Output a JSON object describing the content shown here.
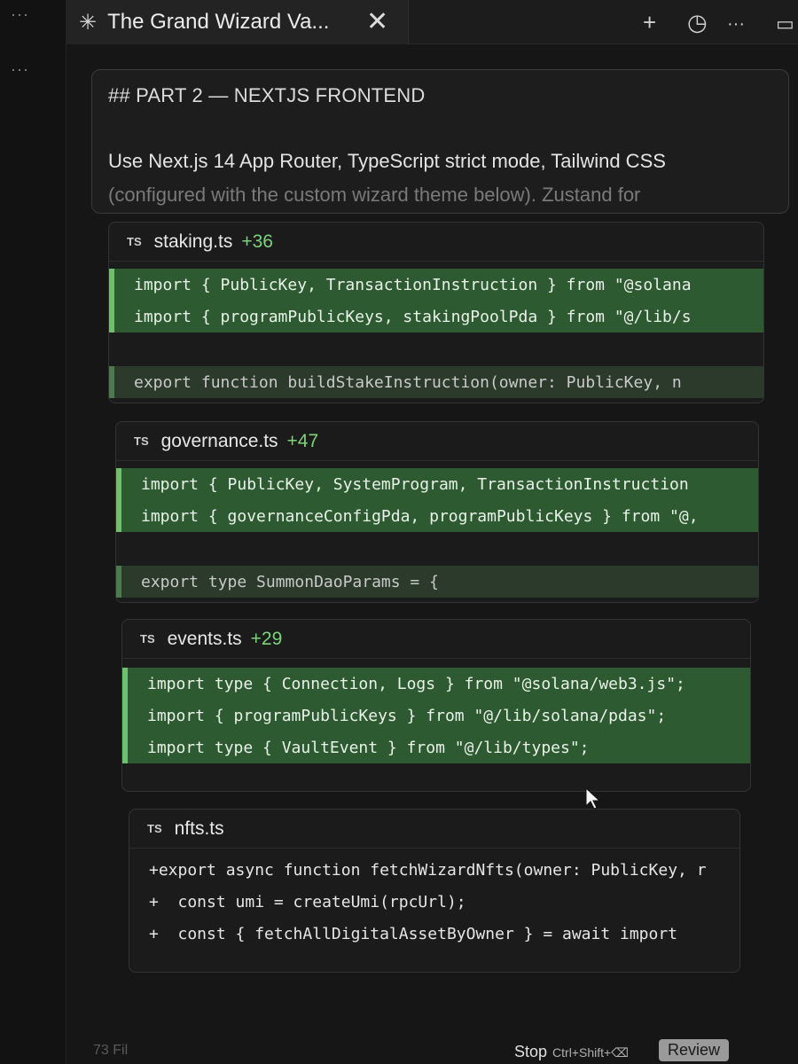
{
  "window": {
    "tab_title": "The Grand Wizard Va...",
    "more_label": "···"
  },
  "icons": {
    "spinner": "spinner-icon",
    "close": "close-icon",
    "plus": "plus-icon",
    "history": "history-icon",
    "more": "more-icon",
    "panel": "panel-toggle-icon"
  },
  "prompt": {
    "heading": "## PART 2 — NEXTJS FRONTEND",
    "line1": "Use Next.js 14 App Router, TypeScript strict mode, Tailwind CSS",
    "line2": "(configured with the custom wizard theme below). Zustand for"
  },
  "files": [
    {
      "tag": "TS",
      "name": "staking.ts",
      "added": "+36",
      "added_lines": [
        "import { PublicKey, TransactionInstruction } from \"@solana",
        "import { programPublicKeys, stakingPoolPda } from \"@/lib/s"
      ],
      "context_lines": [
        "export function buildStakeInstruction(owner: PublicKey, n"
      ]
    },
    {
      "tag": "TS",
      "name": "governance.ts",
      "added": "+47",
      "added_lines": [
        "import { PublicKey, SystemProgram, TransactionInstruction",
        "import { governanceConfigPda, programPublicKeys } from \"@,"
      ],
      "context_lines": [
        "export type SummonDaoParams = {"
      ]
    },
    {
      "tag": "TS",
      "name": "events.ts",
      "added": "+29",
      "added_lines": [
        "import type { Connection, Logs } from \"@solana/web3.js\";",
        "import { programPublicKeys } from \"@/lib/solana/pdas\";",
        "import type { VaultEvent } from \"@/lib/types\";"
      ],
      "context_lines": []
    },
    {
      "tag": "TS",
      "name": "nfts.ts",
      "added": "",
      "plain_lines": [
        "+export async function fetchWizardNfts(owner: PublicKey, r",
        "+  const umi = createUmi(rpcUrl);",
        "+  const { fetchAllDigitalAssetByOwner } = await import"
      ]
    }
  ],
  "footer": {
    "files_label": "73 Fil",
    "stop_label": "Stop",
    "stop_shortcut": "Ctrl+Shift+⌫",
    "review_label": "Review"
  }
}
